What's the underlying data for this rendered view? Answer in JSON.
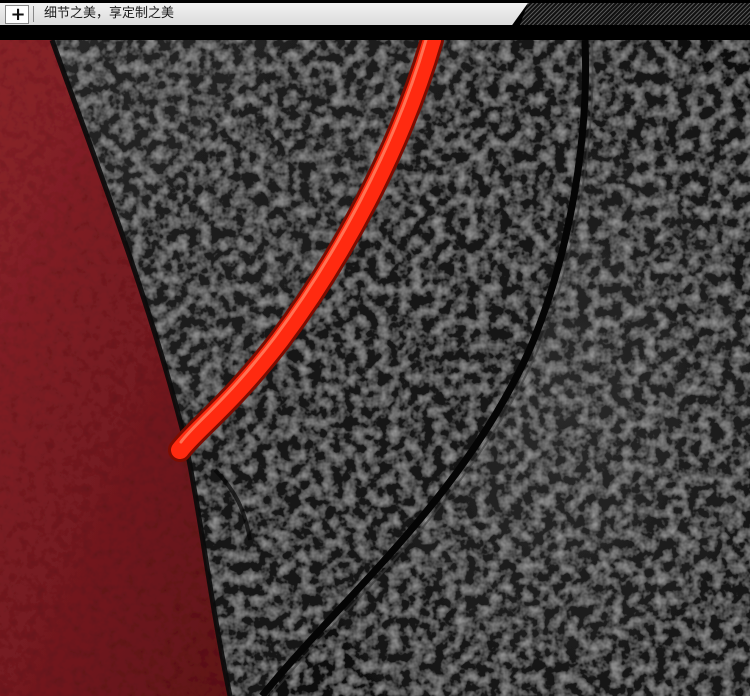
{
  "header": {
    "title": "细节之美，享定制之美",
    "plus_icon": "plus-icon"
  },
  "photo": {
    "subject": "leather-seat-closeup",
    "colors": {
      "red_leather": "#7a1d22",
      "black_leather": "#151515",
      "piping": "#ff2a10"
    }
  }
}
